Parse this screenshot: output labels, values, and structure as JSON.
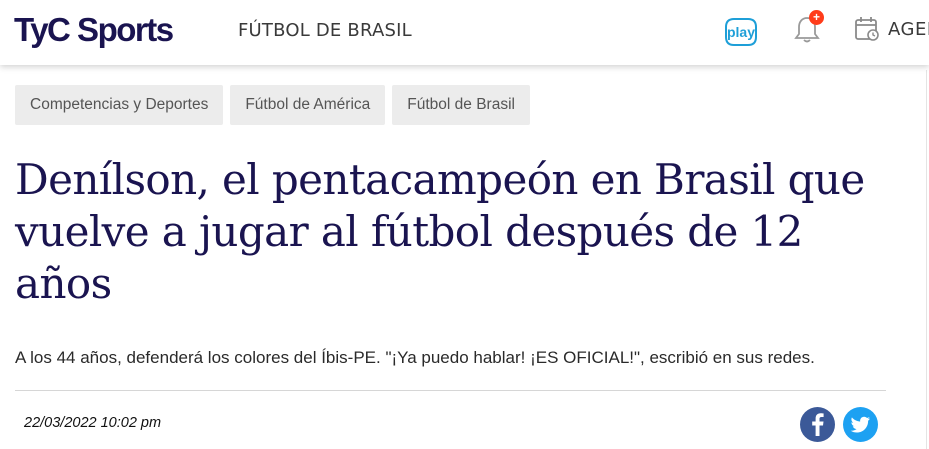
{
  "header": {
    "logo_text": "TyC Sports",
    "section_title": "FÚTBOL DE BRASIL",
    "play_label": "play",
    "notification_badge": "+",
    "agenda_label": "AGEN"
  },
  "breadcrumbs": [
    {
      "label": "Competencias y Deportes"
    },
    {
      "label": "Fútbol de América"
    },
    {
      "label": "Fútbol de Brasil"
    }
  ],
  "article": {
    "headline": "Denílson, el pentacampeón en Brasil que vuelve a jugar al fútbol después de 12 años",
    "summary": "A los 44 años, defenderá los colores del Íbis-PE. \"¡Ya puedo hablar! ¡ES OFICIAL!\", escribió en sus redes.",
    "date": "22/03/2022 10:02 pm"
  },
  "share": {
    "facebook_icon": "facebook-icon",
    "twitter_icon": "twitter-icon"
  },
  "colors": {
    "brand": "#1a1450",
    "play": "#1e9fd8",
    "badge": "#ff3c1a",
    "facebook": "#3b5998",
    "twitter": "#1da1f2"
  }
}
